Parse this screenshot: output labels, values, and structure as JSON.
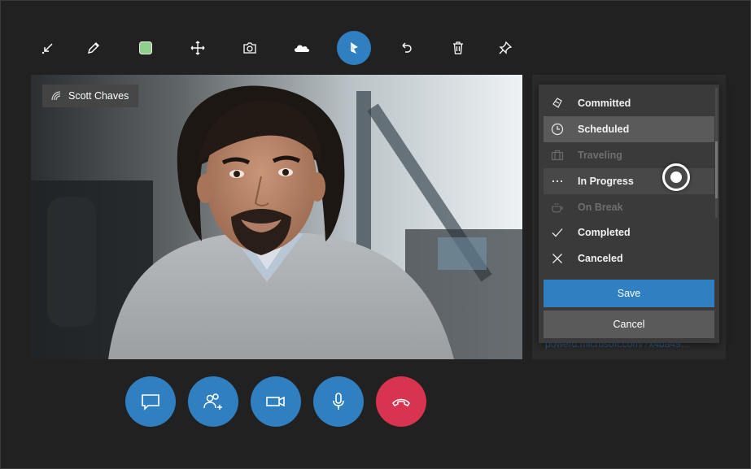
{
  "toolbar": {
    "tools": [
      {
        "name": "minimize-arrow-icon"
      },
      {
        "name": "pencil-icon"
      },
      {
        "name": "color-swatch-icon",
        "color": "#8fd08c"
      },
      {
        "name": "move-icon"
      },
      {
        "name": "camera-icon"
      },
      {
        "name": "cloud-icon"
      },
      {
        "name": "dynamics-logo-icon",
        "active": true
      },
      {
        "name": "undo-icon"
      },
      {
        "name": "trash-icon"
      },
      {
        "name": "pin-icon"
      }
    ],
    "accent_color": "#2f7fc1"
  },
  "video": {
    "participant_name": "Scott Chaves"
  },
  "status_menu": {
    "items": [
      {
        "label": "Committed",
        "icon": "committed-icon",
        "state": "normal"
      },
      {
        "label": "Scheduled",
        "icon": "clock-icon",
        "state": "selected"
      },
      {
        "label": "Traveling",
        "icon": "briefcase-icon",
        "state": "disabled"
      },
      {
        "label": "In Progress",
        "icon": "ellipsis-icon",
        "state": "hover"
      },
      {
        "label": "On Break",
        "icon": "coffee-icon",
        "state": "disabled"
      },
      {
        "label": "Completed",
        "icon": "checkmark-icon",
        "state": "normal"
      },
      {
        "label": "Canceled",
        "icon": "close-icon",
        "state": "normal"
      }
    ],
    "save_label": "Save",
    "cancel_label": "Cancel"
  },
  "side_panel": {
    "link_text": "powerd.microsoft.com/?x4ba49..."
  },
  "call_controls": [
    {
      "name": "chat-button",
      "icon": "chat-icon"
    },
    {
      "name": "add-participant-button",
      "icon": "add-people-icon"
    },
    {
      "name": "video-button",
      "icon": "video-camera-icon"
    },
    {
      "name": "microphone-button",
      "icon": "microphone-icon"
    },
    {
      "name": "end-call-button",
      "icon": "hang-up-icon",
      "color": "#d9344f"
    }
  ]
}
